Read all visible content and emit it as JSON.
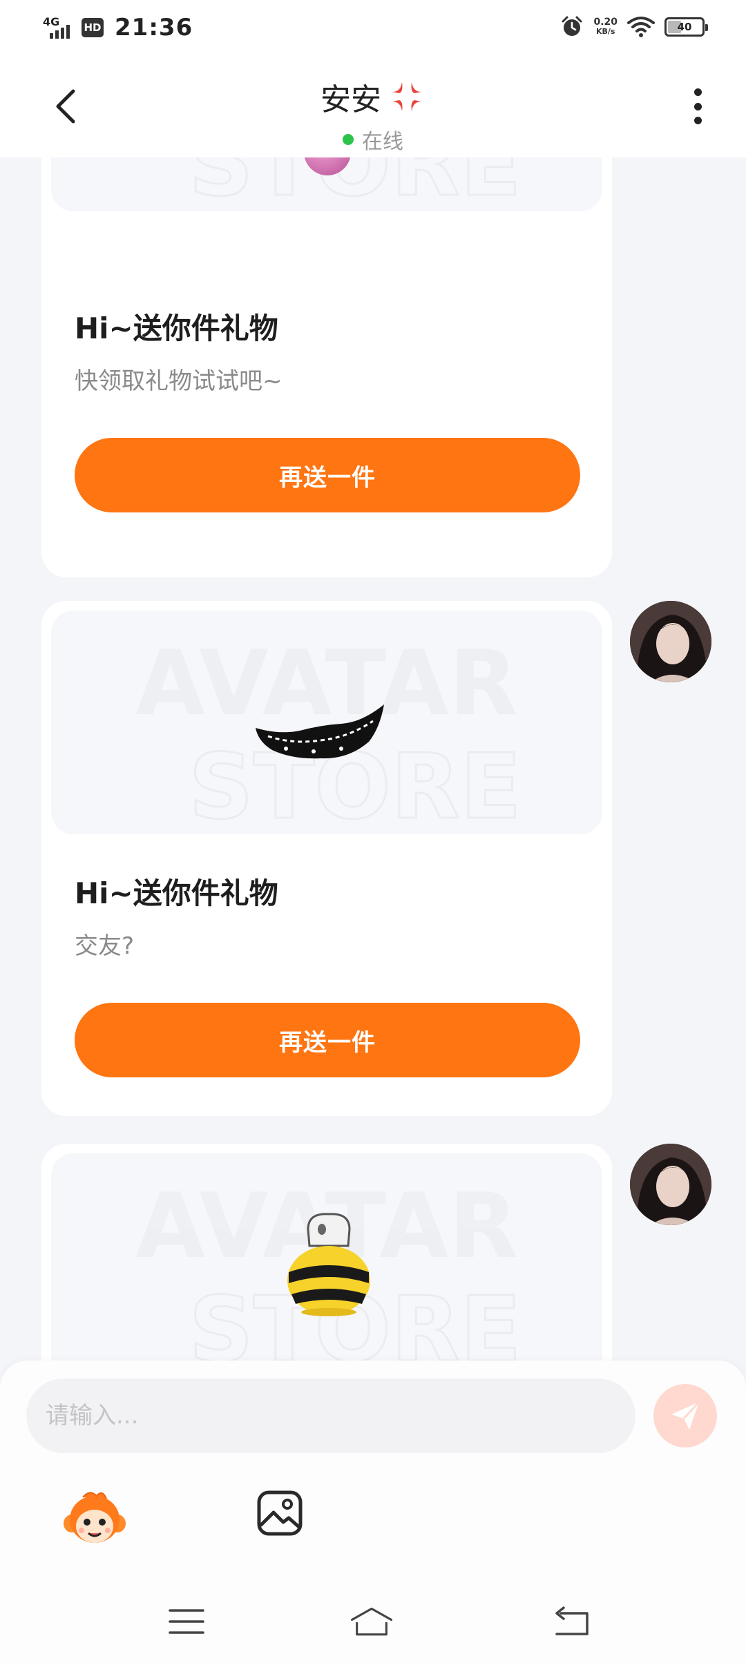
{
  "status_bar": {
    "network": "4G",
    "hd_badge": "HD",
    "time": "21:36",
    "speed_value": "0.20",
    "speed_unit": "KB/s",
    "battery_level": "40",
    "battery_fraction": 0.4
  },
  "header": {
    "contact_name": "安安",
    "mood_icon": "anger-symbol-icon",
    "status_text": "在线",
    "status_color": "#2cc34b"
  },
  "messages": [
    {
      "gift_icon": "pink-ball-gift",
      "title": "Hi~送你件礼物",
      "text": "快领取礼物试试吧~",
      "button": "再送一件"
    },
    {
      "gift_icon": "black-lace-mouth-gift",
      "title": "Hi~送你件礼物",
      "text": "交友?",
      "button": "再送一件"
    },
    {
      "gift_icon": "bee-bottle-gift",
      "title": "",
      "text": "",
      "button": ""
    }
  ],
  "watermark": "AVATAR STORE",
  "input": {
    "placeholder": "请输入..."
  },
  "tools": [
    "monkey-mascot-icon",
    "image-icon"
  ],
  "colors": {
    "accent": "#ff7512",
    "send_disabled": "#ffd9d0",
    "background": "#f4f5f8"
  }
}
